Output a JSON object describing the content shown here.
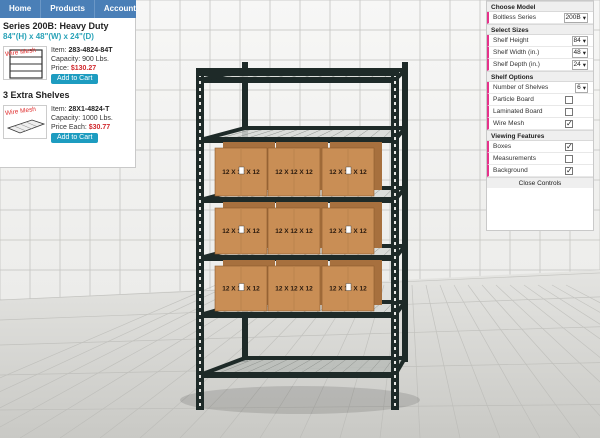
{
  "nav": {
    "items": [
      "Home",
      "Products",
      "Account"
    ]
  },
  "product": {
    "series_title": "Series 200B: Heavy Duty",
    "dimensions": "84\"(H) x 48\"(W) x 24\"(D)",
    "thumb_tag": "Wire Mesh",
    "item_label": "Item:",
    "item_code": "283-4824-84T",
    "capacity": "Capacity: 900 Lbs.",
    "price_label": "Price:",
    "price": "$130.27",
    "add_label": "Add to Cart"
  },
  "extra": {
    "title": "3 Extra Shelves",
    "thumb_tag": "Wire Mesh",
    "item_label": "Item:",
    "item_code": "28X1-4824-T",
    "capacity": "Capacity: 1000 Lbs.",
    "price_label": "Price Each:",
    "price": "$30.77",
    "add_label": "Add to Cart"
  },
  "controls": {
    "choose_model": {
      "header": "Choose Model",
      "series_label": "Boltless Series",
      "series_value": "200B"
    },
    "sizes": {
      "header": "Select Sizes",
      "height_label": "Shelf Height",
      "height_value": "84",
      "width_label": "Shelf Width (in.)",
      "width_value": "48",
      "depth_label": "Shelf Depth (in.)",
      "depth_value": "24"
    },
    "options": {
      "header": "Shelf Options",
      "num_label": "Number of Shelves",
      "num_value": "6",
      "particle_label": "Particle Board",
      "particle_checked": false,
      "laminated_label": "Laminated Board",
      "laminated_checked": false,
      "wire_label": "Wire Mesh",
      "wire_checked": true
    },
    "viewing": {
      "header": "Viewing Features",
      "boxes_label": "Boxes",
      "boxes_checked": true,
      "measure_label": "Measurements",
      "measure_checked": false,
      "bg_label": "Background",
      "bg_checked": true
    },
    "close_label": "Close Controls"
  },
  "scene": {
    "box_label": "12 X 12 X 12",
    "colors": {
      "rack": "#1e2a28",
      "box": "#c98e55",
      "box_dark": "#a7703e",
      "wall": "#f4f4f2",
      "floor": "#cfcfcb"
    }
  }
}
